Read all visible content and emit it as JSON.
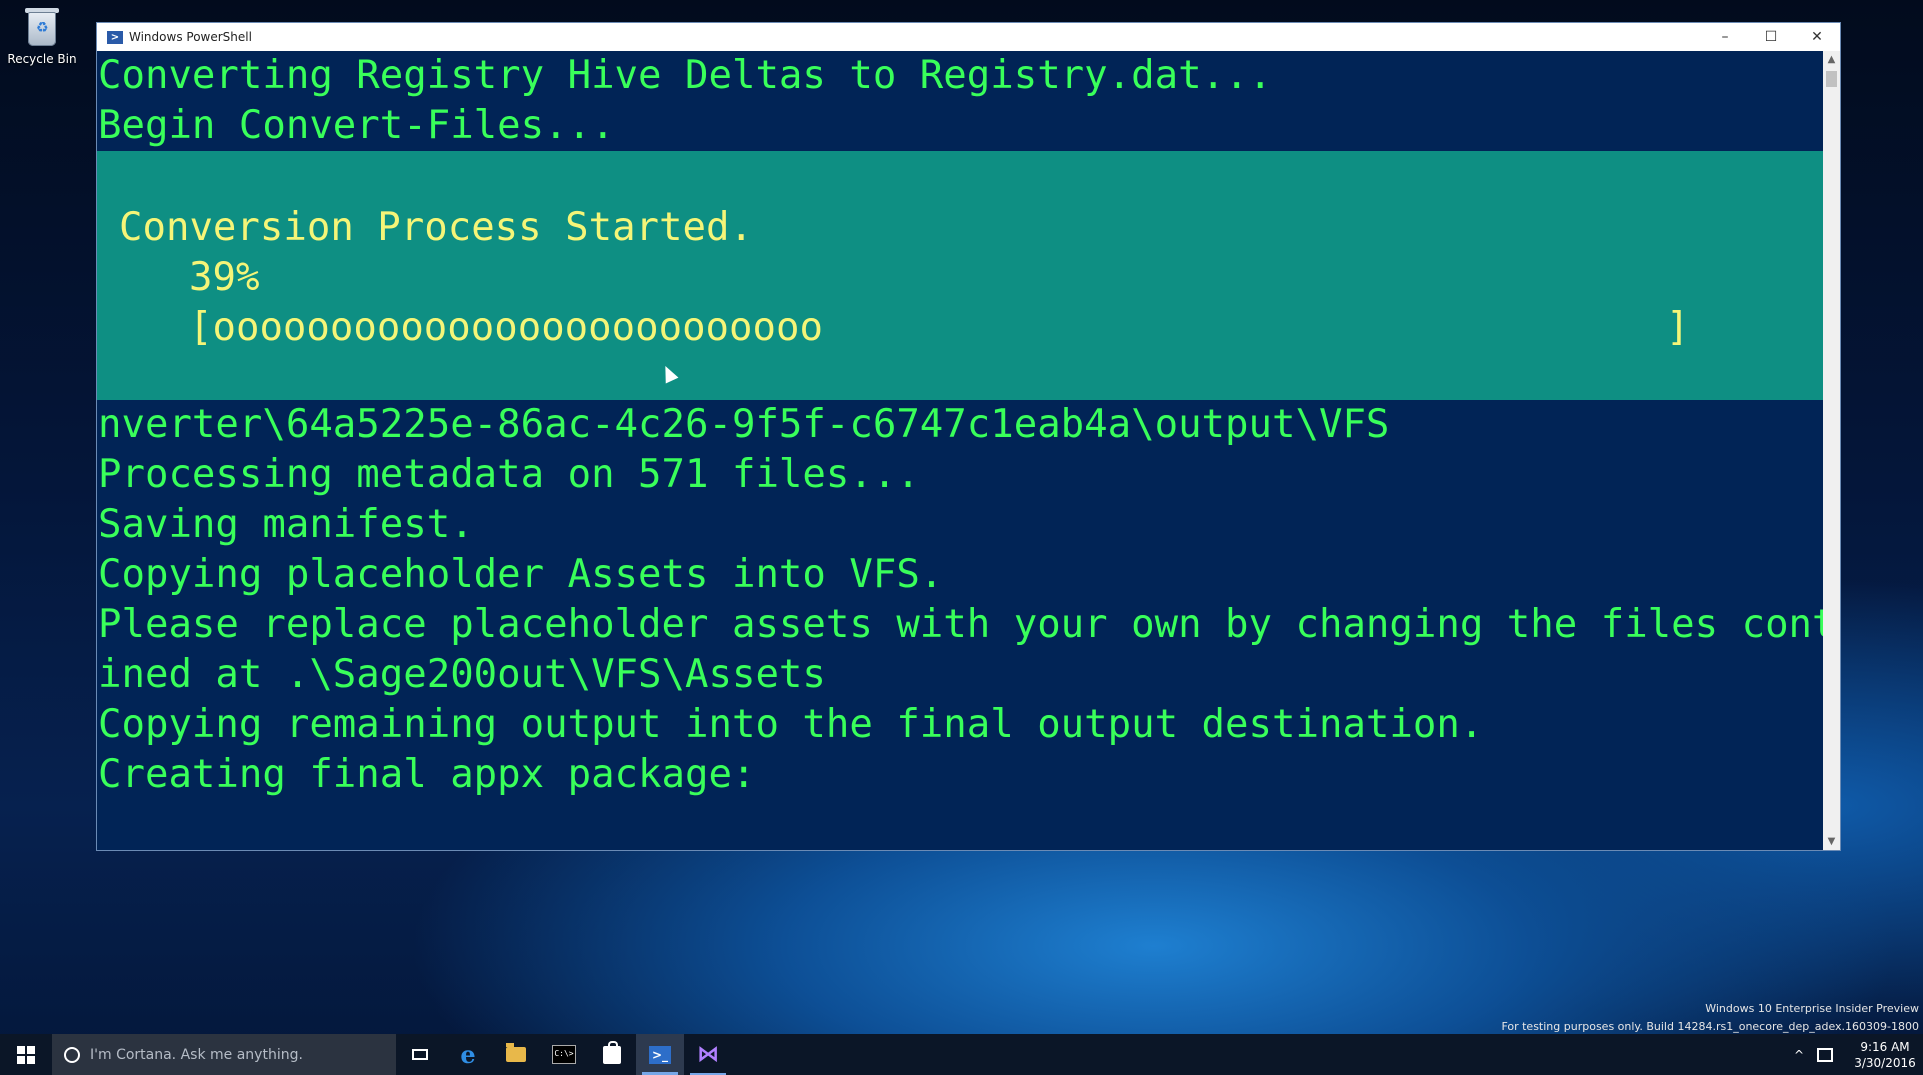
{
  "desktop": {
    "recycle_bin_label": "Recycle Bin",
    "watermark_line1": "Windows 10 Enterprise Insider Preview",
    "watermark_line2": "For testing purposes only. Build 14284.rs1_onecore_dep_adex.160309-1800"
  },
  "window": {
    "title": "Windows PowerShell",
    "controls": {
      "minimize": "–",
      "maximize": "☐",
      "close": "✕"
    }
  },
  "console": {
    "top_lines": [
      "Converting Registry Hive Deltas to Registry.dat...",
      "Begin Convert-Files..."
    ],
    "progress": {
      "title": "Conversion Process Started.",
      "percent_text": "39%",
      "percent": 39,
      "bar": "[oooooooooooooooooooooooooo",
      "bar_end": "]"
    },
    "bottom_lines": [
      "nverter\\64a5225e-86ac-4c26-9f5f-c6747c1eab4a\\output\\VFS",
      "Processing metadata on 571 files...",
      "Saving manifest.",
      "Copying placeholder Assets into VFS.",
      "Please replace placeholder assets with your own by changing the files conta",
      "ined at .\\Sage200out\\VFS\\Assets",
      "Copying remaining output into the final output destination.",
      "Creating final appx package:"
    ],
    "colors": {
      "background": "#012456",
      "text": "#39ff5a",
      "progress_background": "#0e8f83",
      "progress_text": "#f5f578"
    }
  },
  "taskbar": {
    "search_placeholder": "I'm Cortana. Ask me anything.",
    "apps": [
      {
        "name": "task-view-icon"
      },
      {
        "name": "edge-icon",
        "glyph": "e"
      },
      {
        "name": "file-explorer-icon"
      },
      {
        "name": "command-prompt-icon",
        "glyph": "C:\\>"
      },
      {
        "name": "store-icon"
      },
      {
        "name": "powershell-icon",
        "glyph": ">_"
      },
      {
        "name": "visual-studio-icon",
        "glyph": "⋈"
      }
    ],
    "clock": {
      "time": "9:16 AM",
      "date": "3/30/2016"
    }
  }
}
